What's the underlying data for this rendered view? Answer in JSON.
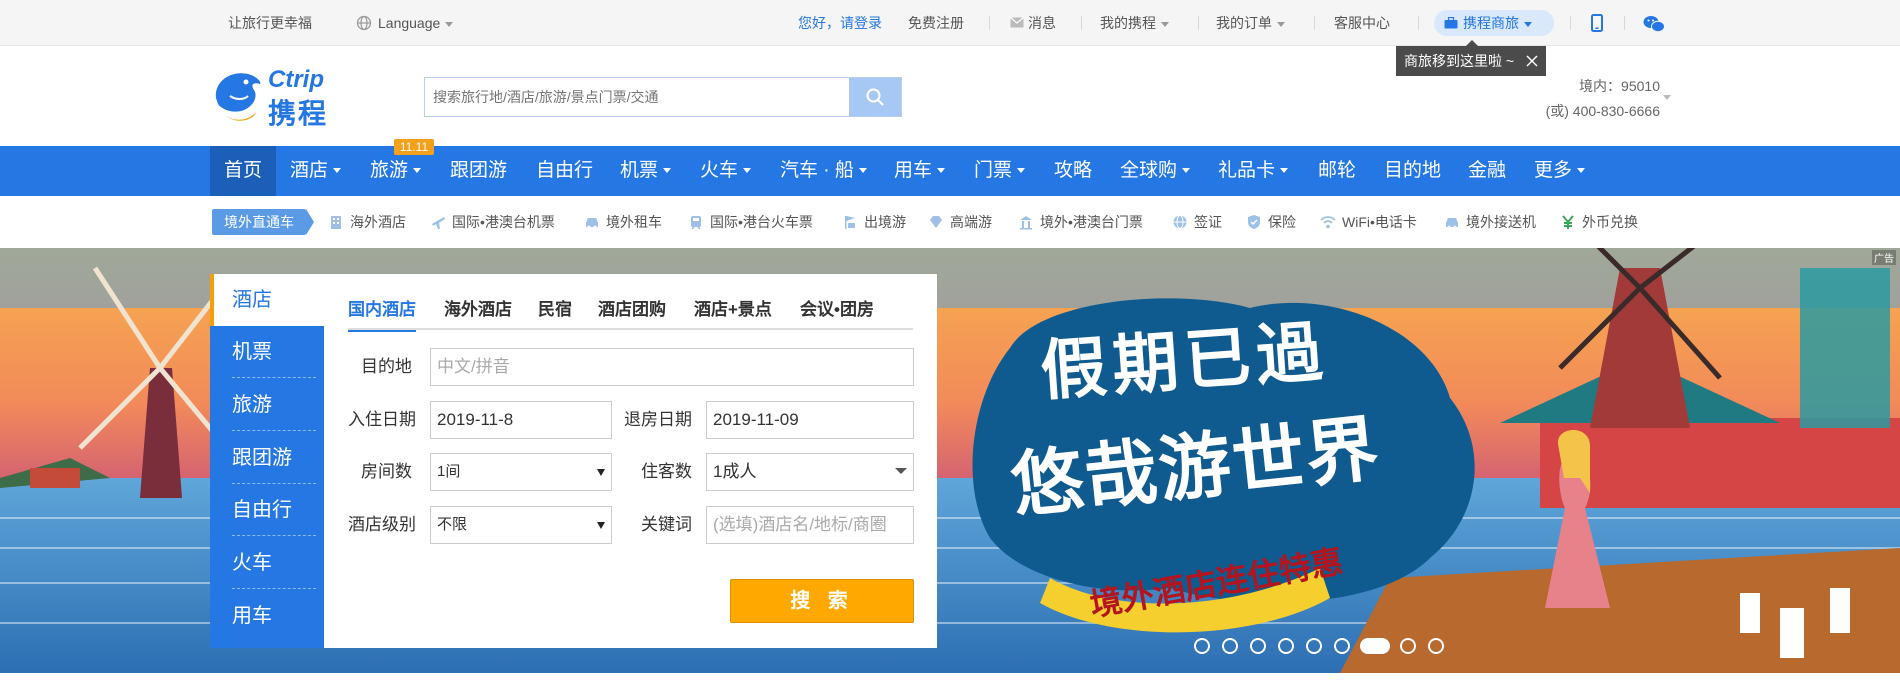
{
  "topbar": {
    "slogan": "让旅行更幸福",
    "language": "Language",
    "greeting": "您好，",
    "login": "请登录",
    "register": "免费注册",
    "messages": "消息",
    "my_ctrip": "我的携程",
    "my_orders": "我的订单",
    "service": "客服中心",
    "business": "携程商旅",
    "tooltip": "商旅移到这里啦 ~"
  },
  "header": {
    "logo_brand": "Ctrip",
    "logo_cn": "携程",
    "search_placeholder": "搜索旅行地/酒店/旅游/景点门票/交通",
    "hotline_domestic": "境内：95010",
    "hotline_alt": "(或) 400-830-6666"
  },
  "nav": {
    "badge": "11.11",
    "items": [
      {
        "label": "首页"
      },
      {
        "label": "酒店"
      },
      {
        "label": "旅游"
      },
      {
        "label": "跟团游"
      },
      {
        "label": "自由行"
      },
      {
        "label": "机票"
      },
      {
        "label": "火车"
      },
      {
        "label": "汽车 · 船"
      },
      {
        "label": "用车"
      },
      {
        "label": "门票"
      },
      {
        "label": "攻略"
      },
      {
        "label": "全球购"
      },
      {
        "label": "礼品卡"
      },
      {
        "label": "邮轮"
      },
      {
        "label": "目的地"
      },
      {
        "label": "金融"
      },
      {
        "label": "更多"
      }
    ]
  },
  "subnav": {
    "tag": "境外直通车",
    "items": [
      {
        "label": "海外酒店"
      },
      {
        "label": "国际•港澳台机票"
      },
      {
        "label": "境外租车"
      },
      {
        "label": "国际•港台火车票"
      },
      {
        "label": "出境游"
      },
      {
        "label": "高端游"
      },
      {
        "label": "境外•港澳台门票"
      },
      {
        "label": "签证"
      },
      {
        "label": "保险"
      },
      {
        "label": "WiFi•电话卡"
      },
      {
        "label": "境外接送机"
      },
      {
        "label": "外币兑换"
      }
    ]
  },
  "side_menu": [
    "酒店",
    "机票",
    "旅游",
    "跟团游",
    "自由行",
    "火车",
    "用车"
  ],
  "booking": {
    "tabs": [
      "国内酒店",
      "海外酒店",
      "民宿",
      "酒店团购",
      "酒店+景点",
      "会议•团房"
    ],
    "destination_label": "目的地",
    "destination_placeholder": "中文/拼音",
    "checkin_label": "入住日期",
    "checkin_value": "2019-11-8",
    "checkout_label": "退房日期",
    "checkout_value": "2019-11-09",
    "rooms_label": "房间数",
    "rooms_value": "1间",
    "guests_label": "住客数",
    "guests_value": "1成人",
    "level_label": "酒店级别",
    "level_value": "不限",
    "keyword_label": "关键词",
    "keyword_placeholder": "(选填)酒店名/地标/商圈",
    "search_button": "搜 索"
  },
  "banner": {
    "ad_tag": "广告",
    "headline_1": "假期已過",
    "headline_2": "悠哉游世界",
    "subline": "境外酒店连住特惠",
    "slide_count": 9,
    "active_slide": 7
  }
}
